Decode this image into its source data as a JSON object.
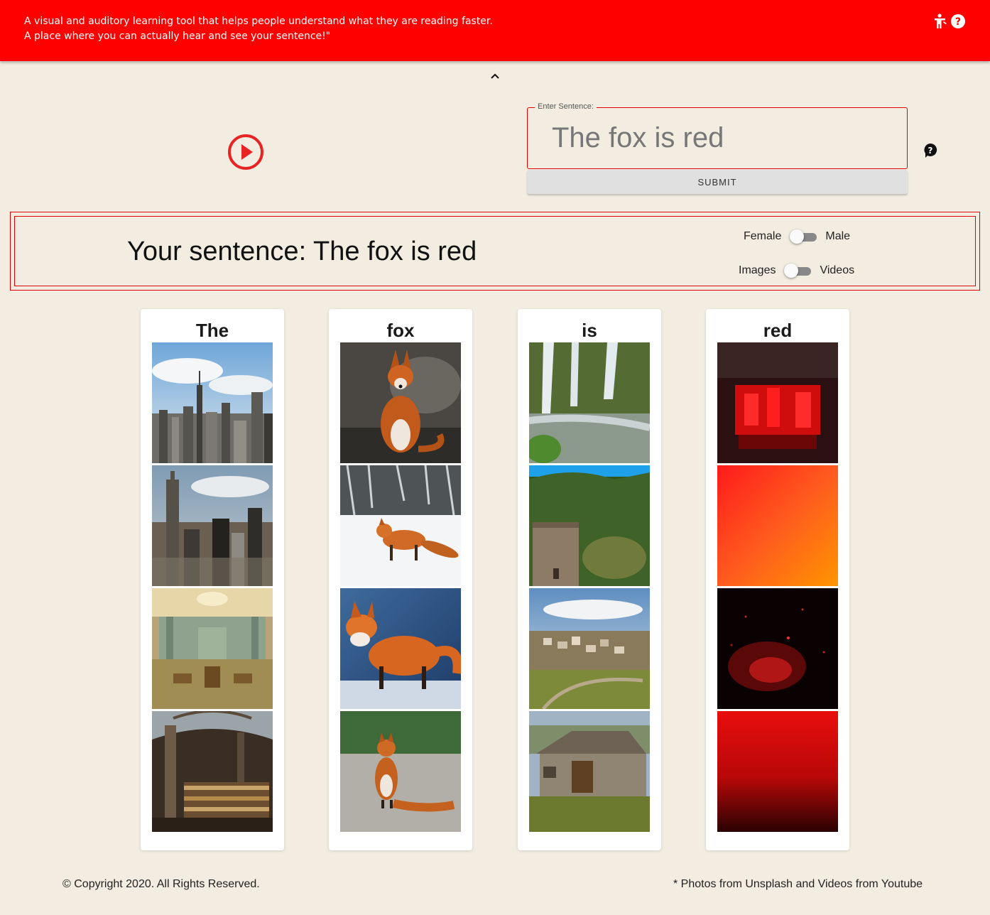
{
  "header": {
    "tagline_line1": "A visual and auditory learning tool that helps people understand what they are reading faster.",
    "tagline_line2": "A place where you can actually hear and see your sentence!\"",
    "background_color": "#ff0000",
    "icons": [
      "accessibility-icon",
      "help-icon"
    ]
  },
  "input": {
    "legend": "Enter Sentence:",
    "value": "The fox is red",
    "submit_label": "SUBMIT"
  },
  "result": {
    "sentence": "Your sentence: The fox is red",
    "voice_toggle": {
      "left_label": "Female",
      "right_label": "Male",
      "selected": "Female"
    },
    "media_toggle": {
      "left_label": "Images",
      "right_label": "Videos",
      "selected": "Images"
    }
  },
  "words": [
    {
      "word": "The",
      "images": [
        "city skyline",
        "city aerial",
        "ornate hall",
        "library interior"
      ]
    },
    {
      "word": "fox",
      "images": [
        "fox sitting",
        "fox in snow",
        "fox on snow",
        "fox on gravel"
      ]
    },
    {
      "word": "is",
      "images": [
        "waterfall",
        "stone tower on hill",
        "hillside village",
        "stone cottage"
      ]
    },
    {
      "word": "red",
      "images": [
        "red lights",
        "red orange gradient",
        "red sparks",
        "red sea"
      ]
    }
  ],
  "footer": {
    "copyright": "© Copyright 2020. All Rights Reserved.",
    "credits": "* Photos from Unsplash and Videos from Youtube"
  },
  "accent_color": "#e82323"
}
